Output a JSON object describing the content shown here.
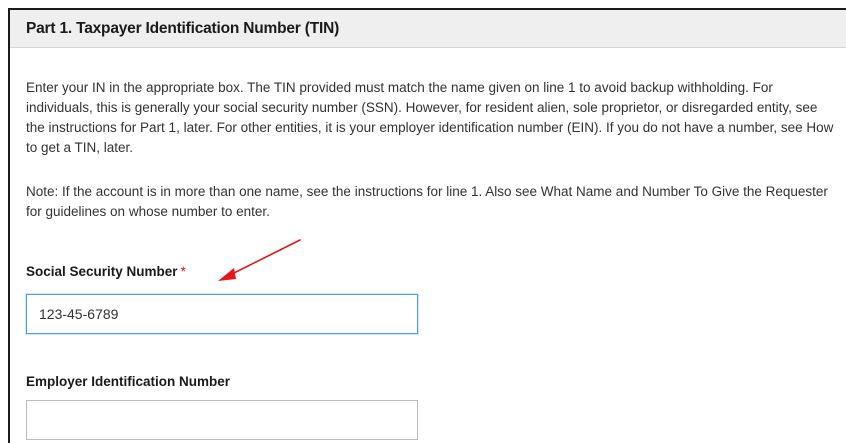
{
  "section": {
    "title": "Part 1. Taxpayer Identification Number (TIN)"
  },
  "paragraphs": {
    "intro": "Enter your IN in the appropriate box. The TIN provided must match the name given on line 1 to avoid backup withholding. For individuals, this is generally your social security number (SSN). However, for resident alien, sole proprietor, or disregarded entity, see the instructions for Part 1, later. For other entities, it is your employer identification number (EIN). If you do not have a number, see How to get a TIN, later.",
    "note": "Note: If the account is in more than one name, see the instructions for line 1. Also see What Name and Number To Give the Requester for guidelines on whose number to enter."
  },
  "fields": {
    "ssn": {
      "label": "Social Security Number",
      "required_marker": "*",
      "value": "123-45-6789",
      "placeholder": ""
    },
    "ein": {
      "label": "Employer Identification Number",
      "value": "",
      "placeholder": ""
    }
  },
  "colors": {
    "required": "#c8102e",
    "focus_border": "#4aa3df",
    "annotation_arrow": "#e3161b",
    "header_background": "#efefef"
  },
  "annotation": {
    "icon": "arrow-icon"
  }
}
